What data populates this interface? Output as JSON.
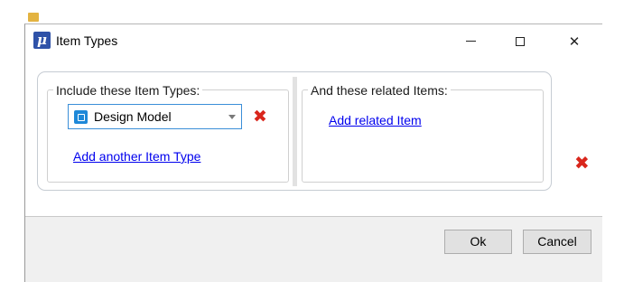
{
  "dialog": {
    "title": "Item Types",
    "app_icon_glyph": "μ",
    "window_controls": {
      "minimize_icon": "minimize-icon",
      "maximize_icon": "maximize-icon",
      "close_icon": "close-icon",
      "close_glyph": "✕"
    }
  },
  "include_group": {
    "legend": "Include these Item Types:",
    "item_type_select": {
      "value": "Design Model",
      "icon": "design-model-icon"
    },
    "remove_glyph": "✖",
    "add_link": "Add another Item Type"
  },
  "related_group": {
    "legend": "And these related Items:",
    "add_link": "Add related Item"
  },
  "remove_row_glyph": "✖",
  "buttons": {
    "ok": "Ok",
    "cancel": "Cancel"
  },
  "colors": {
    "accent": "#3b8fd8",
    "remove": "#d9261c",
    "link": "#0000ee",
    "app_icon": "#2f52a8"
  }
}
